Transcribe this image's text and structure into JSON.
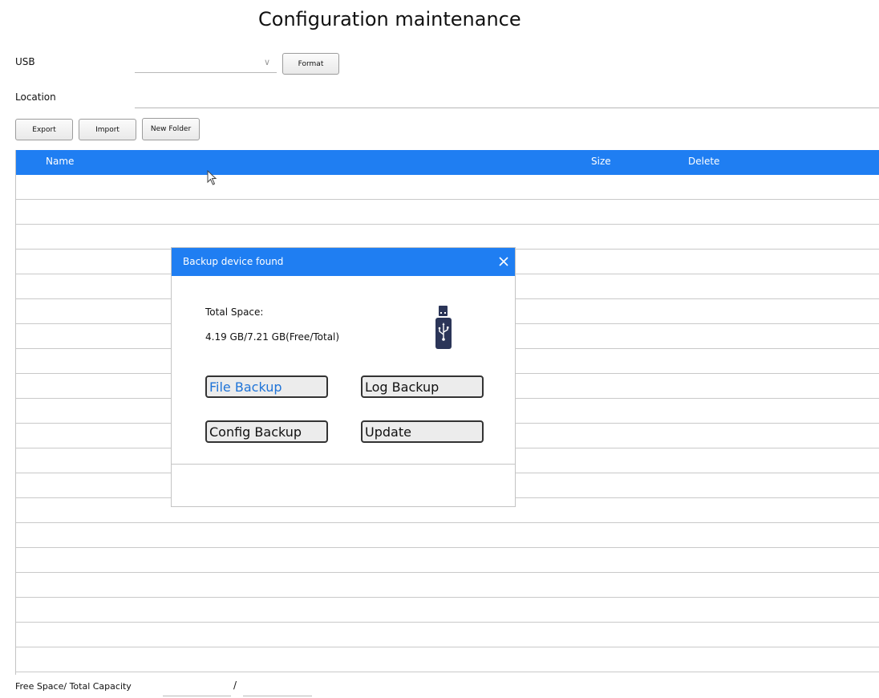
{
  "page": {
    "title": "Configuration maintenance"
  },
  "usb": {
    "label": "USB",
    "selected_value": "",
    "format_label": "Format"
  },
  "location": {
    "label": "Location",
    "value": ""
  },
  "actions": {
    "export_label": "Export",
    "import_label": "Import",
    "new_folder_label": "New Folder"
  },
  "table": {
    "columns": [
      "Name",
      "Size",
      "Delete"
    ],
    "rows": []
  },
  "footer": {
    "label": "Free Space/ Total Capacity",
    "separator": "/",
    "free_space": "",
    "total_capacity": ""
  },
  "dialog": {
    "title": "Backup device found",
    "total_space_label": "Total Space:",
    "space_value": "4.19 GB/7.21 GB(Free/Total)",
    "buttons": {
      "file_backup": "File Backup",
      "log_backup": "Log Backup",
      "config_backup": "Config Backup",
      "update": "Update"
    },
    "icons": {
      "close": "close-icon",
      "device": "usb-drive-icon"
    }
  },
  "colors": {
    "accent": "#1f7ef2",
    "active_text": "#1f74d8"
  }
}
